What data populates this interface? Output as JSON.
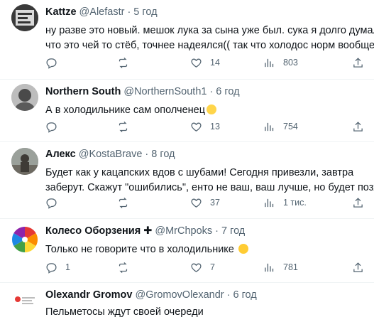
{
  "colors": {
    "text": "#0f1419",
    "secondary": "#536471",
    "divider": "#eff3f4"
  },
  "tweets": [
    {
      "name": "Kattze",
      "handle": "@Alefastr",
      "separator": "·",
      "time": "5 год",
      "lines": [
        "ну разве это новый. мешок лука за сына уже был. сука я долго думал",
        "что это чей то стёб, точнее надеялся(( так что холодос норм вообще"
      ],
      "replies": "",
      "retweets": "",
      "likes": "14",
      "views": "803"
    },
    {
      "name": "Northern South",
      "handle": "@NorthernSouth1",
      "separator": "·",
      "time": "6 год",
      "lines": [
        "А в холодильнике сам ополченец"
      ],
      "replies": "",
      "retweets": "",
      "likes": "13",
      "views": "754"
    },
    {
      "name": "Алекс",
      "handle": "@KostaBrave",
      "separator": "·",
      "time": "8 год",
      "lines": [
        "Будет  как у кацапских вдов с шубами! Сегодня привезли, завтра",
        "заберут. Скажут \"ошибились\", енто не ваш, ваш лучше, но будет позже."
      ],
      "replies": "",
      "retweets": "",
      "likes": "37",
      "views": "1 тис."
    },
    {
      "name": "Колесо Оборзения",
      "badge": "✚",
      "handle": "@MrChpoks",
      "separator": "·",
      "time": "7 год",
      "lines": [
        "Только не говорите что в холодильнике"
      ],
      "replies": "1",
      "retweets": "",
      "likes": "7",
      "views": "781"
    },
    {
      "name": "Olexandr Gromov",
      "handle": "@GromovOlexandr",
      "separator": "·",
      "time": "6 год",
      "lines": [
        "Пельметосы ждут своей очереди"
      ]
    }
  ]
}
